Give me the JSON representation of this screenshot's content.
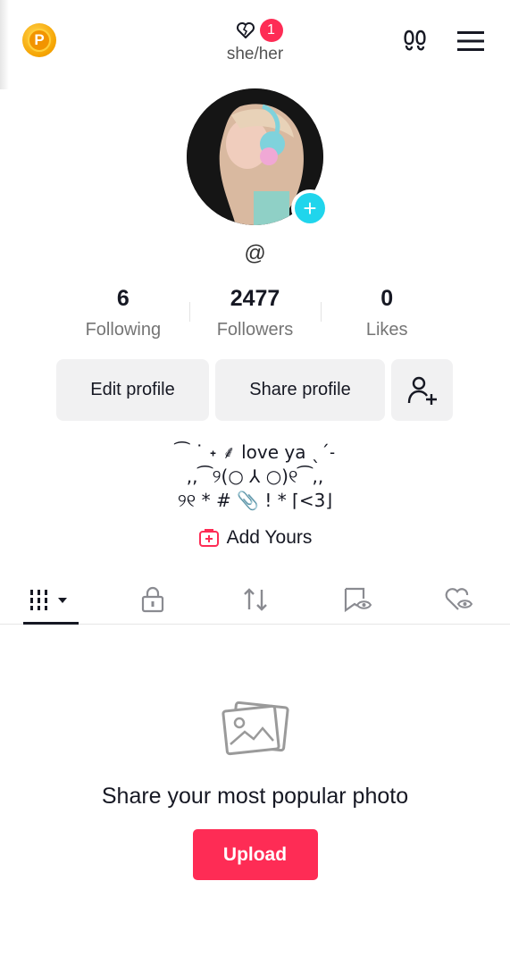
{
  "header": {
    "coin_letter": "P",
    "notification_count": "1",
    "pronouns": "she/her"
  },
  "profile": {
    "username_prefix": "@",
    "username": ""
  },
  "stats": [
    {
      "value": "6",
      "label": "Following"
    },
    {
      "value": "2477",
      "label": "Followers"
    },
    {
      "value": "0",
      "label": "Likes"
    }
  ],
  "actions": {
    "edit_profile": "Edit profile",
    "share_profile": "Share profile"
  },
  "bio": {
    "line1": "⁀ ˙ ˖ ⸙ love ya ˎˊ˗",
    "line2": ",,⁀୨(○ ⅄ ○)୧⁀,,",
    "line3": "୨୧ * # 📎 ! * ⌈<3⌋"
  },
  "add_yours": {
    "label": "Add Yours"
  },
  "tabs": [
    {
      "name": "videos",
      "icon": "grid-icon"
    },
    {
      "name": "private",
      "icon": "lock-icon"
    },
    {
      "name": "reposts",
      "icon": "repost-icon"
    },
    {
      "name": "favorites",
      "icon": "bookmark-eye-icon"
    },
    {
      "name": "liked",
      "icon": "heart-eye-icon"
    }
  ],
  "empty_state": {
    "title": "Share your most popular photo",
    "button": "Upload"
  },
  "colors": {
    "accent": "#fe2c55",
    "cyan": "#20d5ec",
    "coin": "#f5a300"
  }
}
